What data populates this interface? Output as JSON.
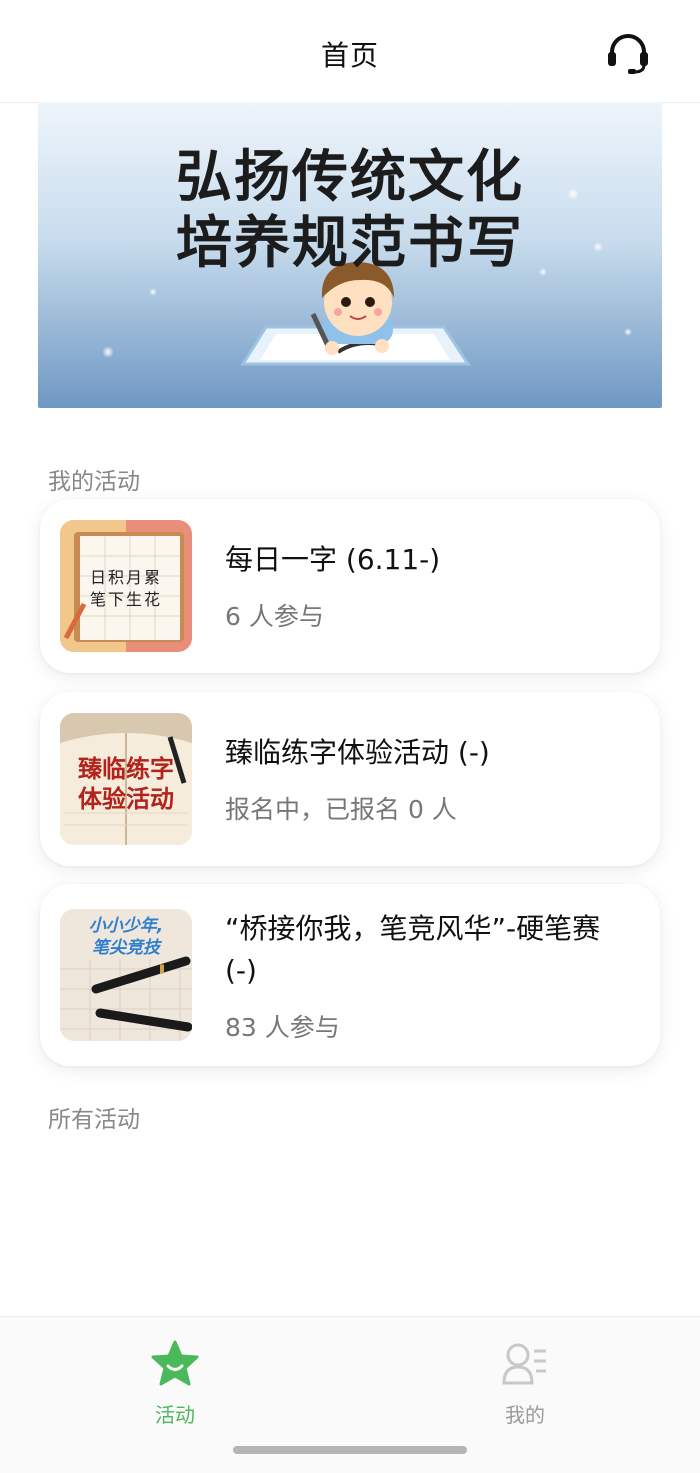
{
  "header": {
    "title": "首页",
    "support_icon": "headset-icon"
  },
  "banner": {
    "line1": "弘扬传统文化",
    "line2": "培养规范书写",
    "thumb_text_1": "日积月累",
    "thumb_text_2": "笔下生花"
  },
  "sections": {
    "my_activities": "我的活动",
    "all_activities": "所有活动"
  },
  "activities": [
    {
      "title": "每日一字 (6.11-)",
      "subtitle": "6 人参与",
      "thumb_line1": "日积月累",
      "thumb_line2": "笔下生花"
    },
    {
      "title": "臻临练字体验活动 (-)",
      "subtitle": "报名中，已报名 0 人",
      "thumb_line1": "臻临练字",
      "thumb_line2": "体验活动"
    },
    {
      "title": "“桥接你我，笔竞风华”-硬笔赛 (-)",
      "subtitle": "83 人参与",
      "thumb_line1": "小小少年,",
      "thumb_line2": "笔尖竞技"
    }
  ],
  "tabbar": {
    "tabs": [
      {
        "label": "活动",
        "icon": "star-face-icon",
        "active": true
      },
      {
        "label": "我的",
        "icon": "user-list-icon",
        "active": false
      }
    ],
    "active_color": "#4cb85c",
    "inactive_color": "#9a9a9a"
  }
}
